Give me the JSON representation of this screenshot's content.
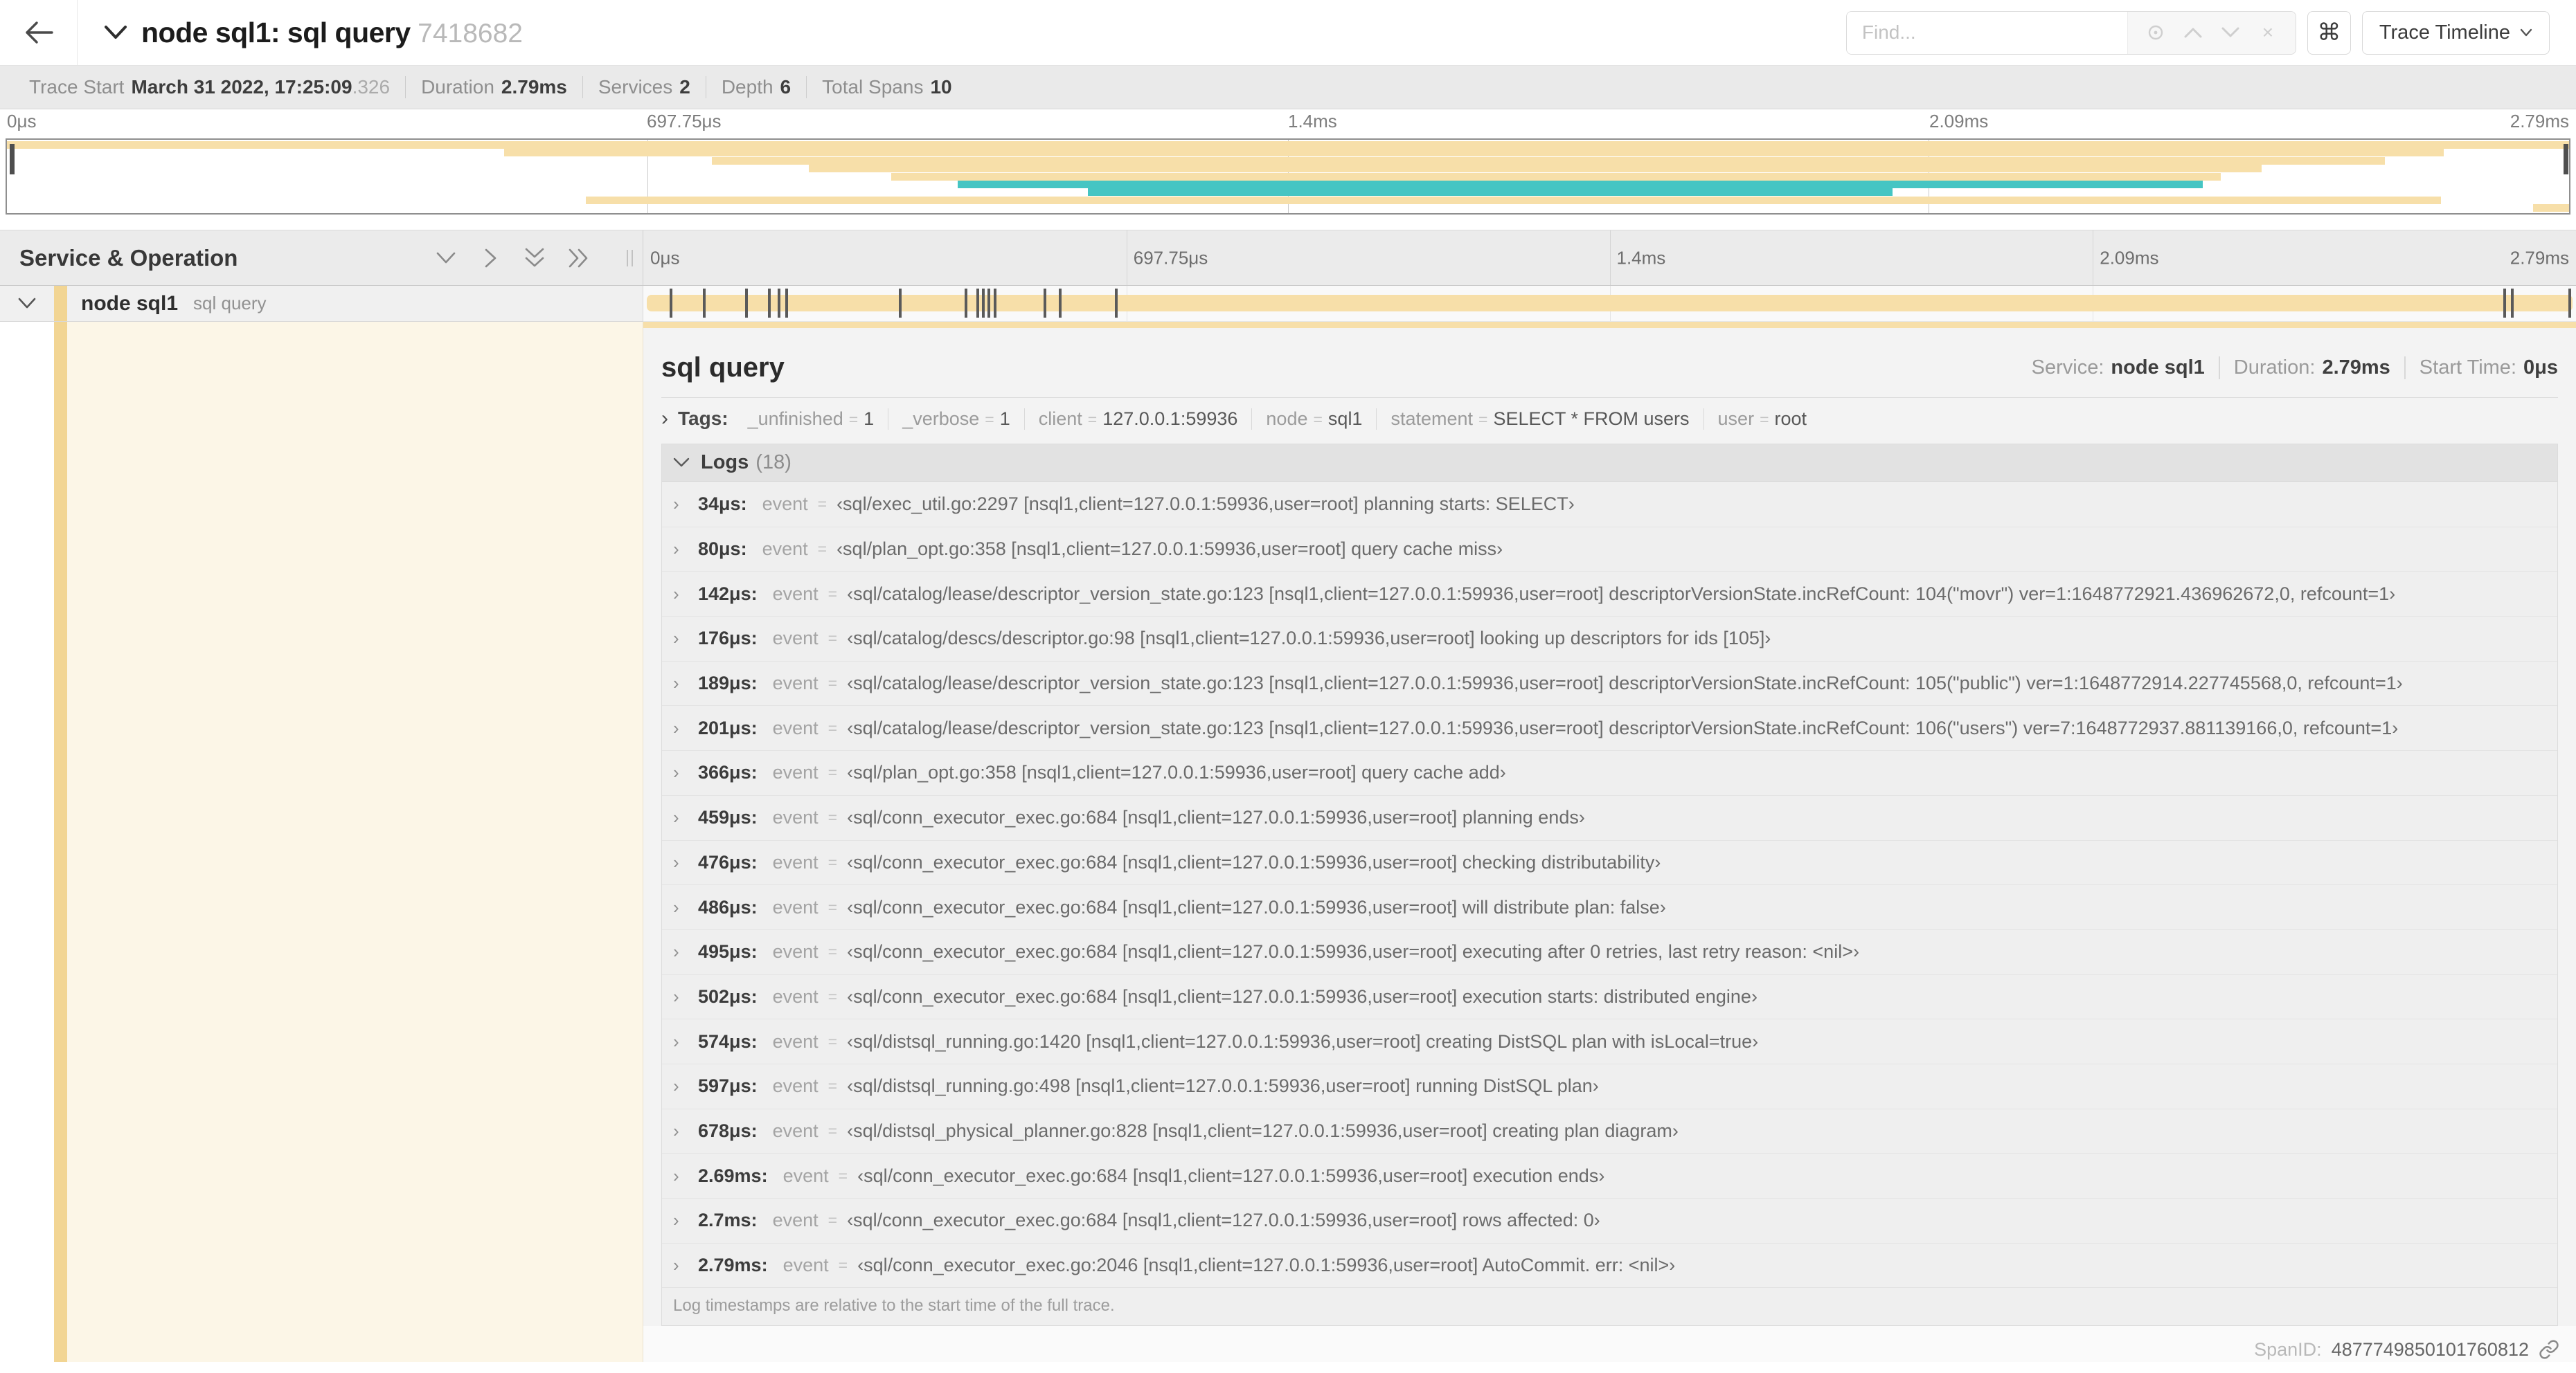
{
  "header": {
    "title": "node sql1: sql query",
    "trace_id": "7418682",
    "find_placeholder": "Find...",
    "cmd_label": "⌘",
    "trace_timeline_label": "Trace Timeline"
  },
  "summary": {
    "items": [
      {
        "label": "Trace Start",
        "value": "March 31 2022, 17:25:09",
        "suffix": ".326"
      },
      {
        "label": "Duration",
        "value": "2.79ms",
        "suffix": ""
      },
      {
        "label": "Services",
        "value": "2",
        "suffix": ""
      },
      {
        "label": "Depth",
        "value": "6",
        "suffix": ""
      },
      {
        "label": "Total Spans",
        "value": "10",
        "suffix": ""
      }
    ]
  },
  "timeline": {
    "ticks": {
      "t0": "0μs",
      "t25": "697.75μs",
      "t50": "1.4ms",
      "t75": "2.09ms",
      "t100": "2.79ms"
    },
    "minimap_rows": [
      {
        "color": "tan",
        "start": 0,
        "end": 1
      },
      {
        "color": "tan",
        "start": 0.194,
        "end": 0.951
      },
      {
        "color": "tan",
        "start": 0.275,
        "end": 0.928
      },
      {
        "color": "tan",
        "start": 0.313,
        "end": 0.88
      },
      {
        "color": "tan",
        "start": 0.345,
        "end": 0.864
      },
      {
        "color": "teal",
        "start": 0.371,
        "end": 0.857
      },
      {
        "color": "teal",
        "start": 0.422,
        "end": 0.736
      },
      {
        "color": "tan",
        "start": 0.226,
        "end": 0.95
      },
      {
        "color": "tan",
        "start": 0.986,
        "end": 1
      }
    ],
    "log_marker_fractions": [
      0.012,
      0.029,
      0.051,
      0.063,
      0.068,
      0.072,
      0.131,
      0.165,
      0.171,
      0.174,
      0.177,
      0.18,
      0.206,
      0.214,
      0.243,
      0.964,
      0.968,
      0.998
    ]
  },
  "span_list": {
    "header_title": "Service & Operation",
    "row": {
      "service": "node sql1",
      "operation": "sql query"
    }
  },
  "detail": {
    "title": "sql query",
    "overview": [
      {
        "label": "Service:",
        "value": "node sql1"
      },
      {
        "label": "Duration:",
        "value": "2.79ms"
      },
      {
        "label": "Start Time:",
        "value": "0μs"
      }
    ],
    "tags_chevron": "›",
    "tags_label": "Tags:",
    "tags": [
      {
        "key": "_unfinished",
        "eq": "=",
        "value": "1"
      },
      {
        "key": "_verbose",
        "eq": "=",
        "value": "1"
      },
      {
        "key": "client",
        "eq": "=",
        "value": "127.0.0.1:59936"
      },
      {
        "key": "node",
        "eq": "=",
        "value": "sql1"
      },
      {
        "key": "statement",
        "eq": "=",
        "value": "SELECT * FROM users"
      },
      {
        "key": "user",
        "eq": "=",
        "value": "root"
      }
    ],
    "logs_title": "Logs",
    "logs_count": "(18)",
    "event_label": "event",
    "eq_sign": "=",
    "row_chevron": "›",
    "logs": [
      {
        "t": "34μs:",
        "v": "‹sql/exec_util.go:2297 [nsql1,client=127.0.0.1:59936,user=root] planning starts: SELECT›"
      },
      {
        "t": "80μs:",
        "v": "‹sql/plan_opt.go:358 [nsql1,client=127.0.0.1:59936,user=root] query cache miss›"
      },
      {
        "t": "142μs:",
        "v": "‹sql/catalog/lease/descriptor_version_state.go:123 [nsql1,client=127.0.0.1:59936,user=root] descriptorVersionState.incRefCount: 104(\"movr\") ver=1:1648772921.436962672,0, refcount=1›"
      },
      {
        "t": "176μs:",
        "v": "‹sql/catalog/descs/descriptor.go:98 [nsql1,client=127.0.0.1:59936,user=root] looking up descriptors for ids [105]›"
      },
      {
        "t": "189μs:",
        "v": "‹sql/catalog/lease/descriptor_version_state.go:123 [nsql1,client=127.0.0.1:59936,user=root] descriptorVersionState.incRefCount: 105(\"public\") ver=1:1648772914.227745568,0, refcount=1›"
      },
      {
        "t": "201μs:",
        "v": "‹sql/catalog/lease/descriptor_version_state.go:123 [nsql1,client=127.0.0.1:59936,user=root] descriptorVersionState.incRefCount: 106(\"users\") ver=7:1648772937.881139166,0, refcount=1›"
      },
      {
        "t": "366μs:",
        "v": "‹sql/plan_opt.go:358 [nsql1,client=127.0.0.1:59936,user=root] query cache add›"
      },
      {
        "t": "459μs:",
        "v": "‹sql/conn_executor_exec.go:684 [nsql1,client=127.0.0.1:59936,user=root] planning ends›"
      },
      {
        "t": "476μs:",
        "v": "‹sql/conn_executor_exec.go:684 [nsql1,client=127.0.0.1:59936,user=root] checking distributability›"
      },
      {
        "t": "486μs:",
        "v": "‹sql/conn_executor_exec.go:684 [nsql1,client=127.0.0.1:59936,user=root] will distribute plan: false›"
      },
      {
        "t": "495μs:",
        "v": "‹sql/conn_executor_exec.go:684 [nsql1,client=127.0.0.1:59936,user=root] executing after 0 retries, last retry reason: <nil>›"
      },
      {
        "t": "502μs:",
        "v": "‹sql/conn_executor_exec.go:684 [nsql1,client=127.0.0.1:59936,user=root] execution starts: distributed engine›"
      },
      {
        "t": "574μs:",
        "v": "‹sql/distsql_running.go:1420 [nsql1,client=127.0.0.1:59936,user=root] creating DistSQL plan with isLocal=true›"
      },
      {
        "t": "597μs:",
        "v": "‹sql/distsql_running.go:498 [nsql1,client=127.0.0.1:59936,user=root] running DistSQL plan›"
      },
      {
        "t": "678μs:",
        "v": "‹sql/distsql_physical_planner.go:828 [nsql1,client=127.0.0.1:59936,user=root] creating plan diagram›"
      },
      {
        "t": "2.69ms:",
        "v": "‹sql/conn_executor_exec.go:684 [nsql1,client=127.0.0.1:59936,user=root] execution ends›"
      },
      {
        "t": "2.7ms:",
        "v": "‹sql/conn_executor_exec.go:684 [nsql1,client=127.0.0.1:59936,user=root] rows affected: 0›"
      },
      {
        "t": "2.79ms:",
        "v": "‹sql/conn_executor_exec.go:2046 [nsql1,client=127.0.0.1:59936,user=root] AutoCommit. err: <nil>›"
      }
    ],
    "footer_note": "Log timestamps are relative to the start time of the full trace.",
    "span_id_label": "SpanID:",
    "span_id": "4877749850101760812"
  },
  "colors": {
    "tan": "#f7dfa9",
    "teal": "#45c5c3",
    "accent_bar": "#f2d593",
    "cream": "#fcf6e7",
    "marker": "#5a5a5a"
  }
}
